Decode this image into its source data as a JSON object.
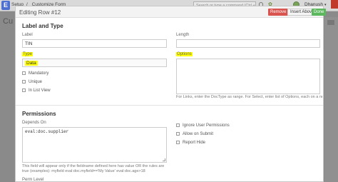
{
  "navbar": {
    "logo_letter": "E",
    "breadcrumbs": [
      "Setup",
      "Customize Form"
    ],
    "search_placeholder": "Search or type a command (Ctrl + G)",
    "user_name": "Dhanush"
  },
  "background": {
    "page_title": "Cu"
  },
  "modal": {
    "title": "Editing Row #12",
    "buttons": {
      "remove": "Remove",
      "insert_above": "Insert Above",
      "done": "Done"
    },
    "label_and_type": {
      "section_title": "Label and Type",
      "label_field": {
        "label": "Label",
        "value": "TIN"
      },
      "type_field": {
        "label": "Type",
        "value": "Data"
      },
      "length_field": {
        "label": "Length",
        "value": ""
      },
      "options_field": {
        "label": "Options",
        "value": "",
        "help": "For Links, enter the DocType as range. For Select, enter list of Options, each on a new line."
      },
      "checkboxes": [
        "Mandatory",
        "Unique",
        "In List View"
      ]
    },
    "permissions": {
      "section_title": "Permissions",
      "depends_on": {
        "label": "Depends On",
        "value": "eval:doc.supplier",
        "help": "This field will appear only if the fieldname defined here has value OR the rules are true (examples): myfield eval:doc.myfield=='My Value' eval:doc.age>18"
      },
      "checkboxes": [
        "Ignore User Permissions",
        "Allow on Submit",
        "Report Hide"
      ],
      "perm_level_label": "Perm Level"
    }
  },
  "colors": {
    "highlight": "#ffff00",
    "remove": "#d9534f",
    "done": "#5cb85c",
    "logo": "#4f6fd0"
  }
}
